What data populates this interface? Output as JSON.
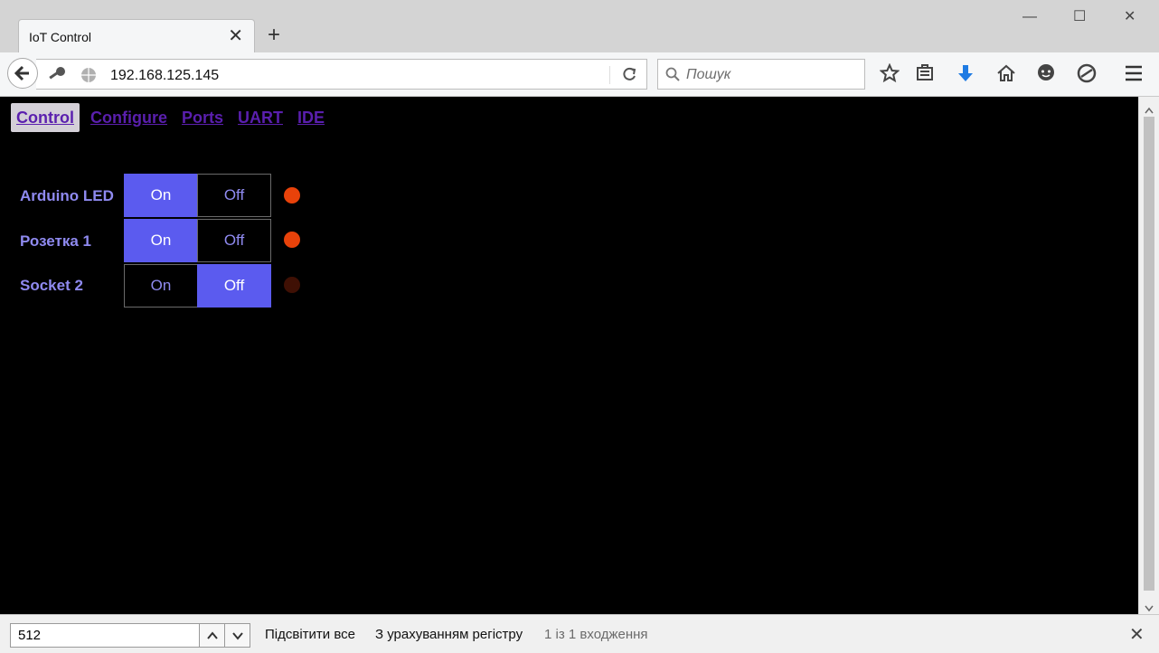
{
  "window": {
    "tab_title": "IoT Control",
    "tab_close": "✕",
    "new_tab": "+",
    "minimize": "—",
    "maximize": "☐",
    "close": "✕"
  },
  "navbar": {
    "url": "192.168.125.145",
    "search_placeholder": "Пошук"
  },
  "page": {
    "nav": [
      {
        "label": "Control",
        "active": true
      },
      {
        "label": "Configure",
        "active": false
      },
      {
        "label": "Ports",
        "active": false
      },
      {
        "label": "UART",
        "active": false
      },
      {
        "label": "IDE",
        "active": false
      }
    ],
    "devices": [
      {
        "name": "Arduino LED",
        "on_label": "On",
        "off_label": "Off",
        "state": "on"
      },
      {
        "name": "Розетка 1",
        "on_label": "On",
        "off_label": "Off",
        "state": "on"
      },
      {
        "name": "Socket 2",
        "on_label": "On",
        "off_label": "Off",
        "state": "off"
      }
    ],
    "colors": {
      "led_on": "#e8420a",
      "led_off": "#3f1004",
      "accent": "#5b5bef"
    }
  },
  "findbar": {
    "query": "512",
    "highlight_all": "Підсвітити все",
    "match_case": "З урахуванням регістру",
    "status": "1 із 1 входження",
    "close": "✕"
  }
}
